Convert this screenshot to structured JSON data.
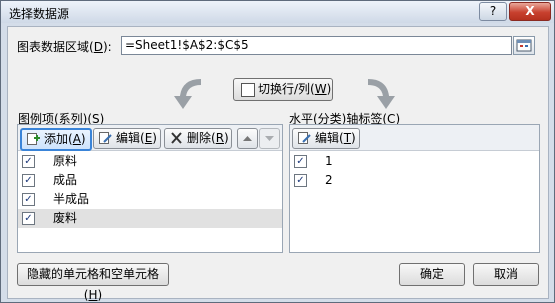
{
  "window": {
    "title": "选择数据源",
    "help_label": "?",
    "close_label": "X"
  },
  "range": {
    "label_prefix": "图表数据区域(",
    "label_key": "D",
    "label_suffix": "):",
    "value": "=Sheet1!$A$2:$C$5"
  },
  "switch_button": {
    "prefix": "切换行/列(",
    "key": "W",
    "suffix": ")"
  },
  "legend": {
    "label_prefix": "图例项(系列)(",
    "label_key": "S",
    "label_suffix": ")",
    "add": {
      "prefix": "添加(",
      "key": "A",
      "suffix": ")"
    },
    "edit": {
      "prefix": "编辑(",
      "key": "E",
      "suffix": ")"
    },
    "remove": {
      "prefix": "删除(",
      "key": "R",
      "suffix": ")"
    },
    "items": [
      {
        "label": "原料",
        "checked": true
      },
      {
        "label": "成品",
        "checked": true
      },
      {
        "label": "半成品",
        "checked": true
      },
      {
        "label": "废料",
        "checked": true,
        "selected": true
      }
    ]
  },
  "axis": {
    "label_prefix": "水平(分类)轴标签(",
    "label_key": "C",
    "label_suffix": ")",
    "edit": {
      "prefix": "编辑(",
      "key": "T",
      "suffix": ")"
    },
    "items": [
      {
        "label": "1",
        "checked": true
      },
      {
        "label": "2",
        "checked": true
      }
    ]
  },
  "footer": {
    "hidden_cells": {
      "prefix": "隐藏的单元格和空单元格(",
      "key": "H",
      "suffix": ")"
    },
    "ok": "确定",
    "cancel": "取消"
  },
  "colors": {
    "titlebar": "#dbe4f0",
    "close": "#c8412f",
    "active_border": "#3a84d8",
    "selected_row": "#e1e1e1"
  },
  "icons": [
    "help-icon",
    "close-icon",
    "collapse-dialog-icon",
    "switch-row-column-icon",
    "add-icon",
    "edit-icon",
    "delete-icon",
    "move-up-icon",
    "move-down-icon",
    "checkbox-icon"
  ]
}
